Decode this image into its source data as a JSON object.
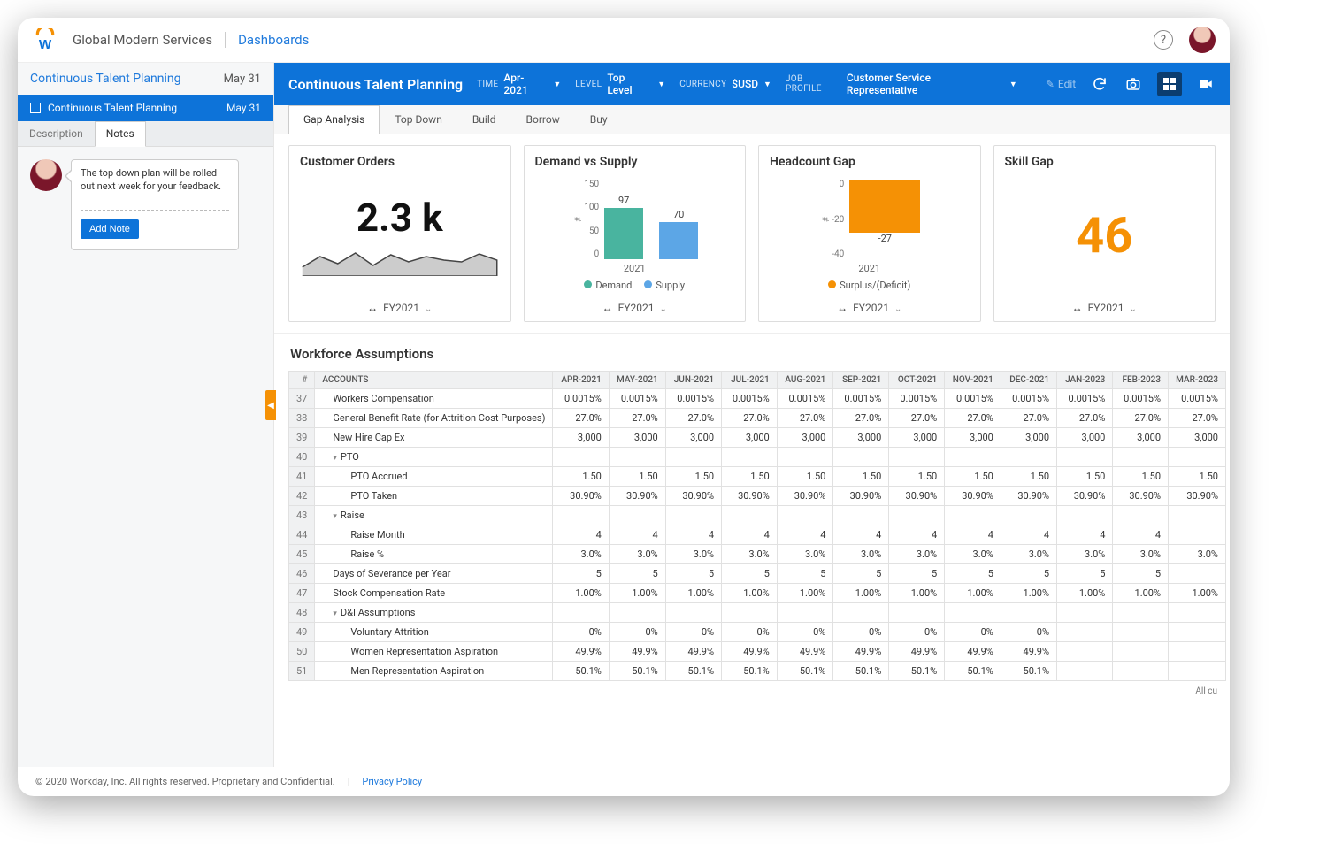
{
  "header": {
    "tenant": "Global Modern Services",
    "breadcrumb": "Dashboards"
  },
  "sidebar": {
    "title": "Continuous Talent Planning",
    "date": "May 31",
    "block": {
      "label": "Continuous Talent Planning",
      "date": "May 31"
    },
    "tabs": {
      "description": "Description",
      "notes": "Notes"
    },
    "note": {
      "text": "The top down plan will be rolled out next week for your feedback.",
      "add_label": "Add Note"
    }
  },
  "bluebar": {
    "title": "Continuous Talent Planning",
    "time": {
      "label": "TIME",
      "value": "Apr-2021"
    },
    "level": {
      "label": "LEVEL",
      "value": "Top Level"
    },
    "currency": {
      "label": "CURRENCY",
      "value": "$USD"
    },
    "jobprofile": {
      "label": "JOB PROFILE",
      "value": "Customer Service Representative"
    },
    "edit_label": "Edit"
  },
  "tabs": [
    "Gap Analysis",
    "Top Down",
    "Build",
    "Borrow",
    "Buy"
  ],
  "cards": {
    "orders": {
      "title": "Customer Orders",
      "value": "2.3 k",
      "period": "FY2021"
    },
    "dvs": {
      "title": "Demand vs Supply",
      "year": "2021",
      "demand_label": "Demand",
      "supply_label": "Supply",
      "period": "FY2021"
    },
    "hc": {
      "title": "Headcount Gap",
      "year": "2021",
      "legend": "Surplus/(Deficit)",
      "period": "FY2021"
    },
    "skill": {
      "title": "Skill Gap",
      "value": "46",
      "period": "FY2021"
    }
  },
  "section": {
    "title": "Workforce Assumptions",
    "corner": "All cu"
  },
  "table": {
    "header_accounts": "Accounts",
    "months": [
      "Apr-2021",
      "May-2021",
      "Jun-2021",
      "Jul-2021",
      "Aug-2021",
      "Sep-2021",
      "Oct-2021",
      "Nov-2021",
      "Dec-2021",
      "Jan-2023",
      "Feb-2023",
      "Mar-2023"
    ],
    "rows": [
      {
        "num": "37",
        "label": "Workers Compensation",
        "indent": 1,
        "cells": [
          "0.0015%",
          "0.0015%",
          "0.0015%",
          "0.0015%",
          "0.0015%",
          "0.0015%",
          "0.0015%",
          "0.0015%",
          "0.0015%",
          "0.0015%",
          "0.0015%",
          "0.0015%"
        ]
      },
      {
        "num": "38",
        "label": "General Benefit Rate (for Attrition Cost Purposes)",
        "indent": 1,
        "cells": [
          "27.0%",
          "27.0%",
          "27.0%",
          "27.0%",
          "27.0%",
          "27.0%",
          "27.0%",
          "27.0%",
          "27.0%",
          "27.0%",
          "27.0%",
          "27.0%"
        ]
      },
      {
        "num": "39",
        "label": "New Hire Cap Ex",
        "indent": 1,
        "cells": [
          "3,000",
          "3,000",
          "3,000",
          "3,000",
          "3,000",
          "3,000",
          "3,000",
          "3,000",
          "3,000",
          "3,000",
          "3,000",
          "3,000"
        ]
      },
      {
        "num": "40",
        "label": "PTO",
        "indent": 1,
        "tree": true,
        "cells": [
          "",
          "",
          "",
          "",
          "",
          "",
          "",
          "",
          "",
          "",
          "",
          ""
        ]
      },
      {
        "num": "41",
        "label": "PTO Accrued",
        "indent": 2,
        "cells": [
          "1.50",
          "1.50",
          "1.50",
          "1.50",
          "1.50",
          "1.50",
          "1.50",
          "1.50",
          "1.50",
          "1.50",
          "1.50",
          "1.50"
        ]
      },
      {
        "num": "42",
        "label": "PTO Taken",
        "indent": 2,
        "cells": [
          "30.90%",
          "30.90%",
          "30.90%",
          "30.90%",
          "30.90%",
          "30.90%",
          "30.90%",
          "30.90%",
          "30.90%",
          "30.90%",
          "30.90%",
          "30.90%"
        ]
      },
      {
        "num": "43",
        "label": "Raise",
        "indent": 1,
        "tree": true,
        "cells": [
          "",
          "",
          "",
          "",
          "",
          "",
          "",
          "",
          "",
          "",
          "",
          ""
        ]
      },
      {
        "num": "44",
        "label": "Raise Month",
        "indent": 2,
        "cells": [
          "4",
          "4",
          "4",
          "4",
          "4",
          "4",
          "4",
          "4",
          "4",
          "4",
          "4",
          ""
        ]
      },
      {
        "num": "45",
        "label": "Raise %",
        "indent": 2,
        "cells": [
          "3.0%",
          "3.0%",
          "3.0%",
          "3.0%",
          "3.0%",
          "3.0%",
          "3.0%",
          "3.0%",
          "3.0%",
          "3.0%",
          "3.0%",
          "3.0%"
        ]
      },
      {
        "num": "46",
        "label": "Days of Severance per Year",
        "indent": 1,
        "cells": [
          "5",
          "5",
          "5",
          "5",
          "5",
          "5",
          "5",
          "5",
          "5",
          "5",
          "5",
          ""
        ]
      },
      {
        "num": "47",
        "label": "Stock Compensation Rate",
        "indent": 1,
        "cells": [
          "1.00%",
          "1.00%",
          "1.00%",
          "1.00%",
          "1.00%",
          "1.00%",
          "1.00%",
          "1.00%",
          "1.00%",
          "1.00%",
          "1.00%",
          "1.00%"
        ]
      },
      {
        "num": "48",
        "label": "D&I Assumptions",
        "indent": 1,
        "tree": true,
        "cells": [
          "",
          "",
          "",
          "",
          "",
          "",
          "",
          "",
          "",
          "",
          "",
          ""
        ]
      },
      {
        "num": "49",
        "label": "Voluntary Attrition",
        "indent": 2,
        "cells": [
          "0%",
          "0%",
          "0%",
          "0%",
          "0%",
          "0%",
          "0%",
          "0%",
          "0%",
          "",
          "",
          ""
        ]
      },
      {
        "num": "50",
        "label": "Women Representation Aspiration",
        "indent": 2,
        "cells": [
          "49.9%",
          "49.9%",
          "49.9%",
          "49.9%",
          "49.9%",
          "49.9%",
          "49.9%",
          "49.9%",
          "49.9%",
          "",
          "",
          ""
        ]
      },
      {
        "num": "51",
        "label": "Men Representation Aspiration",
        "indent": 2,
        "cells": [
          "50.1%",
          "50.1%",
          "50.1%",
          "50.1%",
          "50.1%",
          "50.1%",
          "50.1%",
          "50.1%",
          "50.1%",
          "",
          "",
          ""
        ]
      }
    ]
  },
  "footer": {
    "copyright": "© 2020 Workday, Inc. All rights reserved. Proprietary and Confidential.",
    "privacy": "Privacy Policy"
  },
  "chart_data": [
    {
      "type": "bar",
      "title": "Demand vs Supply",
      "categories": [
        "2021"
      ],
      "series": [
        {
          "name": "Demand",
          "values": [
            97
          ],
          "color": "#49b49f"
        },
        {
          "name": "Supply",
          "values": [
            70
          ],
          "color": "#5ca6e6"
        }
      ],
      "ylabel": "#",
      "ylim": [
        0,
        150
      ],
      "yticks": [
        0,
        50,
        100,
        150
      ]
    },
    {
      "type": "bar",
      "title": "Headcount Gap",
      "categories": [
        "2021"
      ],
      "series": [
        {
          "name": "Surplus/(Deficit)",
          "values": [
            -27
          ],
          "color": "#f59105"
        }
      ],
      "ylabel": "#",
      "ylim": [
        -40,
        0
      ],
      "yticks": [
        -40,
        -20,
        0
      ]
    },
    {
      "type": "line",
      "title": "Customer Orders sparkline",
      "x": [
        0,
        1,
        2,
        3,
        4,
        5,
        6,
        7,
        8,
        9,
        10,
        11
      ],
      "values": [
        2.1,
        2.35,
        2.2,
        2.45,
        2.15,
        2.4,
        2.25,
        2.38,
        2.3,
        2.28,
        2.42,
        2.3
      ],
      "ylim": [
        2.0,
        2.6
      ]
    }
  ]
}
